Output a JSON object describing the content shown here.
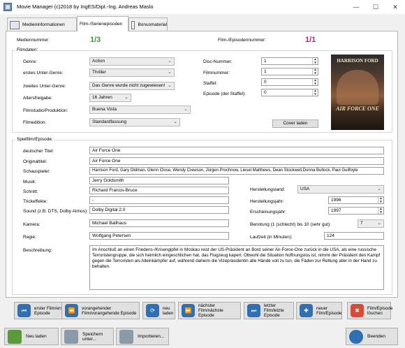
{
  "window": {
    "title": "Movie Manager (c)2018 by IngES/Dipl.-Ing. Andreas Maslo",
    "minimize": "—",
    "maximize": "☐",
    "close": "✕"
  },
  "tabs": [
    {
      "label": "Medieninformationen"
    },
    {
      "label": "Film-/Serienepisoden"
    },
    {
      "label": "Bonusmaterial"
    }
  ],
  "header": {
    "media_number_label": "Mediennummer:",
    "media_number_value": "1/3",
    "episode_number_label": "Film-/Episodennummer:",
    "episode_number_value": "1/1"
  },
  "filmdaten": {
    "title": "Filmdaten:",
    "genre_label": "Genre:",
    "genre_value": "Action",
    "sub1_label": "erstes Unter-Genre:",
    "sub1_value": "Thriller",
    "sub2_label": "zweites Unter-Genre:",
    "sub2_value": "Das Genre wurde nicht zugewiesen!",
    "age_label": "Altersfreigabe:",
    "age_value": "16 Jahren",
    "studio_label": "Filmstudio/Produktion:",
    "studio_value": "Buena Vista",
    "edition_label": "Filmedition:",
    "edition_value": "Standardfassung",
    "disc_label": "Disc-Nummer:",
    "disc_value": "1",
    "filmnr_label": "Filmnummer:",
    "filmnr_value": "1",
    "season_label": "Staffel:",
    "season_value": "0",
    "episode_label": "Episode (der Staffel):",
    "episode_value": "0",
    "cover_button": "Cover laden",
    "poster_top": "HARRISON FORD",
    "poster_title": "AIR FORCE ONE"
  },
  "spielfilm": {
    "title": "Spielfilm/Episode:",
    "german_title_label": "deutscher Titel:",
    "german_title_value": "Air Force One",
    "original_title_label": "Originaltitel:",
    "original_title_value": "Air Force One",
    "actors_label": "Schauspieler:",
    "actors_value": "Harrison Ford, Gary Oldman, Glenn Close, Wendy Crewson, Jürgen Prochnow, Liesel Matthews, Dean Stockwell,Donna Bullock, Paul Guilfoyle",
    "music_label": "Musik:",
    "music_value": "Jerry Goldsmith",
    "cut_label": "Schnitt:",
    "cut_value": "Richard Francis-Bruce",
    "effects_label": "Trickeffekte:",
    "effects_value": "-",
    "sound_label": "Sound (z.B. DTS, Dolby Atmos):",
    "sound_value": "Dolby Digital 2.0",
    "camera_label": "Kamera:",
    "camera_value": "Michael Ballhaus",
    "director_label": "Regie:",
    "director_value": "Wolfgang Petersen",
    "country_label": "Herstellungsland:",
    "country_value": "USA",
    "year_label": "Herstellungsjahr:",
    "year_value": "1996",
    "release_label": "Erscheinungsjahr:",
    "release_value": "1997",
    "rating_label": "Benotung (1 (schlecht) bis 10 (sehr gut):",
    "rating_value": "7",
    "runtime_label": "Laufzeit (in Minuten):",
    "runtime_value": "124",
    "description_label": "Beschreibung:",
    "description_value": "Im Anschluß an einen Friedens-/Krisengipfel in Moskau reist der US-Präsident an Bord seiner Air-Force-One zurück in die USA, als eine russische Terroristengruppe, die sich heimlich eingeschlichen hat, das Flugzeug kapert. Obwohl die Situation hoffnungslos ist, nimmt der Präsident den Kampf gegen die Terroristen als Alleinkämpfer auf, während daheim die Vizepräsidentin alle Hände voll zu tun, die Fäden zur Rettung aller in der Hand zu behalten."
  },
  "nav": {
    "first_line1": "erster Film/erste",
    "first_line2": "Episode",
    "prev_line1": "vorangehender",
    "prev_line2": "Film/vorangehende Episode",
    "reload_line1": "neu",
    "reload_line2": "laden",
    "next_line1": "nächster Film/nächste",
    "next_line2": "Episode",
    "last_line1": "letzter Film/letzte",
    "last_line2": "Episode",
    "new_line1": "neuer",
    "new_line2": "Film/Episode",
    "delete_line1": "Film/Episode",
    "delete_line2": "löschen"
  },
  "bottom": {
    "reload": "Neu laden",
    "save": "Speichern unter...",
    "import": "Importieren...",
    "exit": "Beenden"
  },
  "colors": {
    "media_number": "#3a9a3a",
    "episode_number": "#c2187f",
    "nav_icon": "#2f6fb3"
  }
}
